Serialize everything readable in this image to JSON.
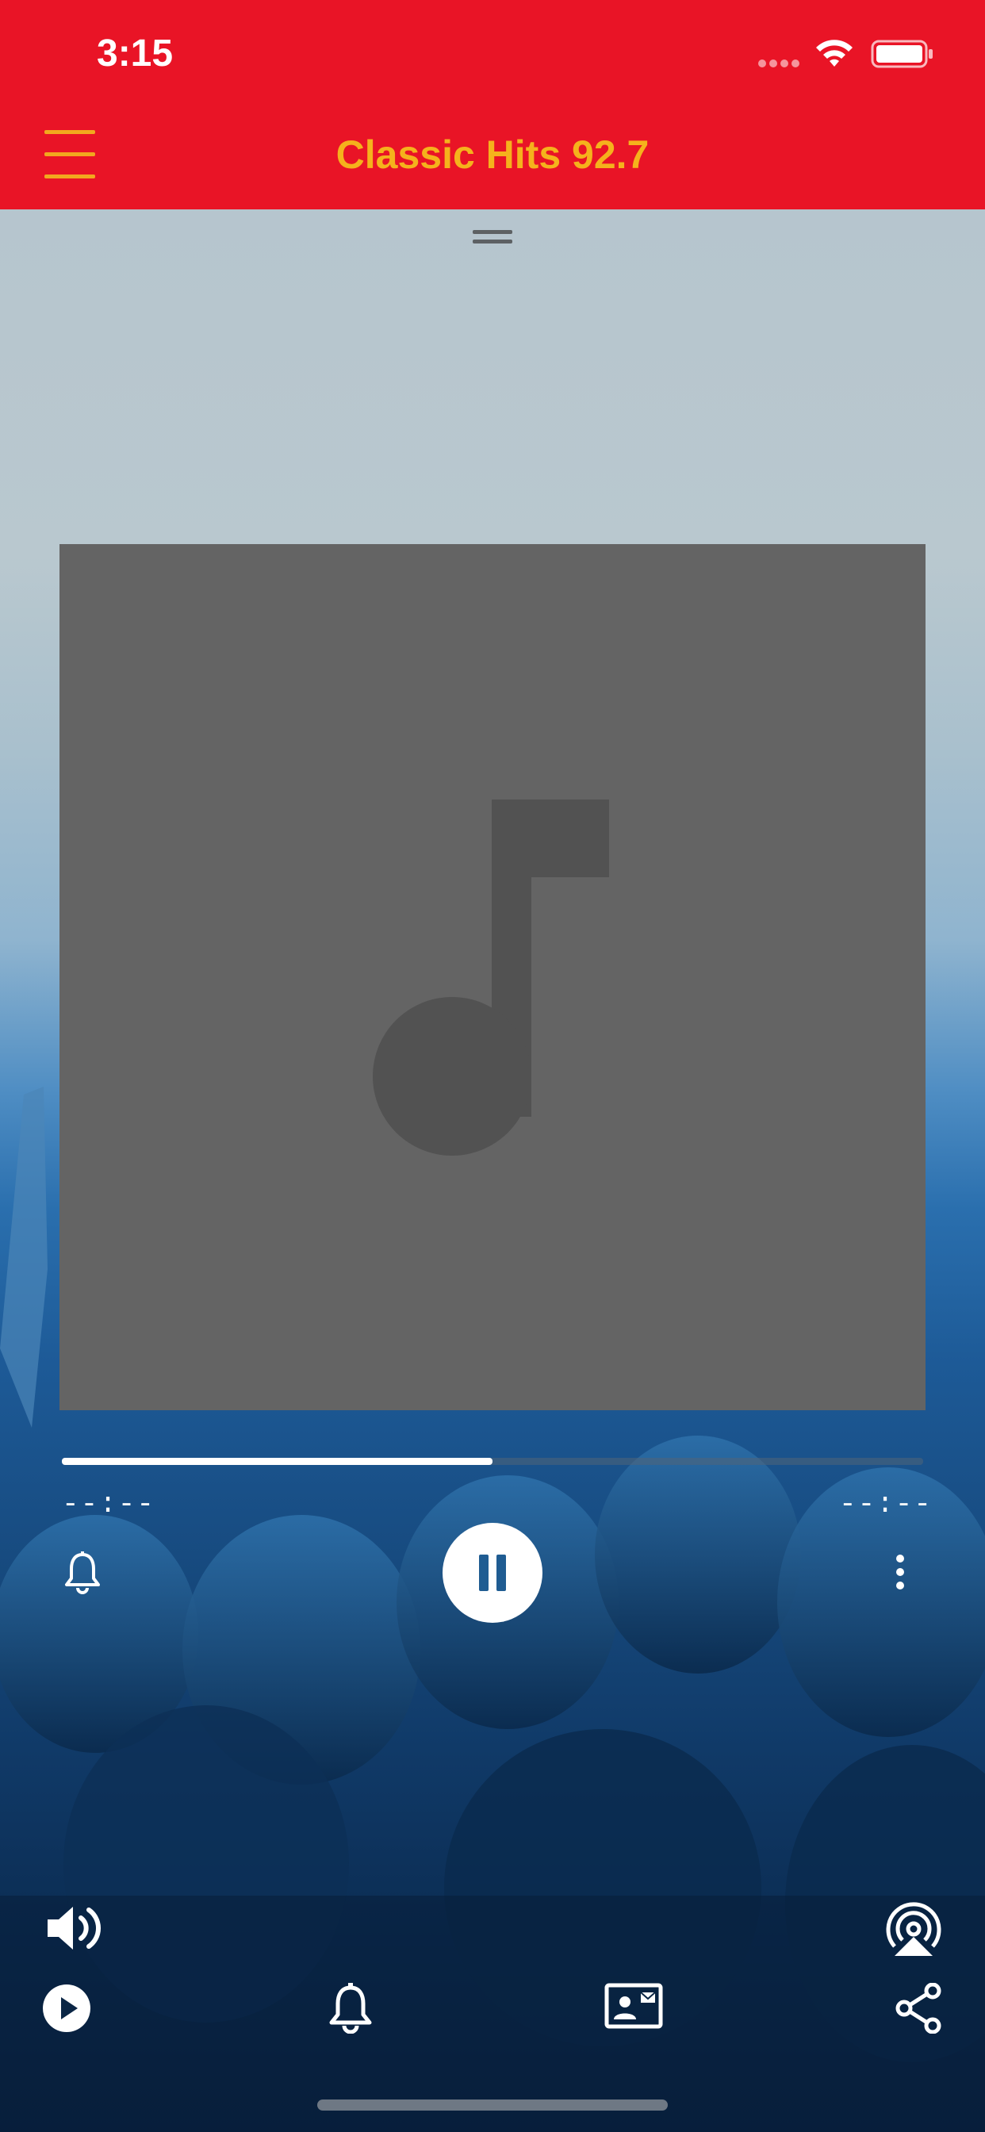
{
  "status_bar": {
    "time": "3:15"
  },
  "header": {
    "title": "Classic Hits 92.7",
    "background_color": "#e91426",
    "title_color": "#f5b21c"
  },
  "player": {
    "artwork_icon": "music-note-icon",
    "progress_fraction": 0.5,
    "elapsed": "--:--",
    "remaining": "--:--",
    "state": "playing"
  },
  "controls": {
    "alarm_icon": "bell-icon",
    "pause_icon": "pause-icon",
    "more_icon": "more-vertical-icon",
    "volume_icon": "speaker-icon",
    "airplay_icon": "airplay-icon"
  },
  "tab_bar": {
    "items": [
      {
        "icon": "play-circle-icon"
      },
      {
        "icon": "bell-icon"
      },
      {
        "icon": "contact-card-icon"
      },
      {
        "icon": "share-icon"
      }
    ]
  }
}
